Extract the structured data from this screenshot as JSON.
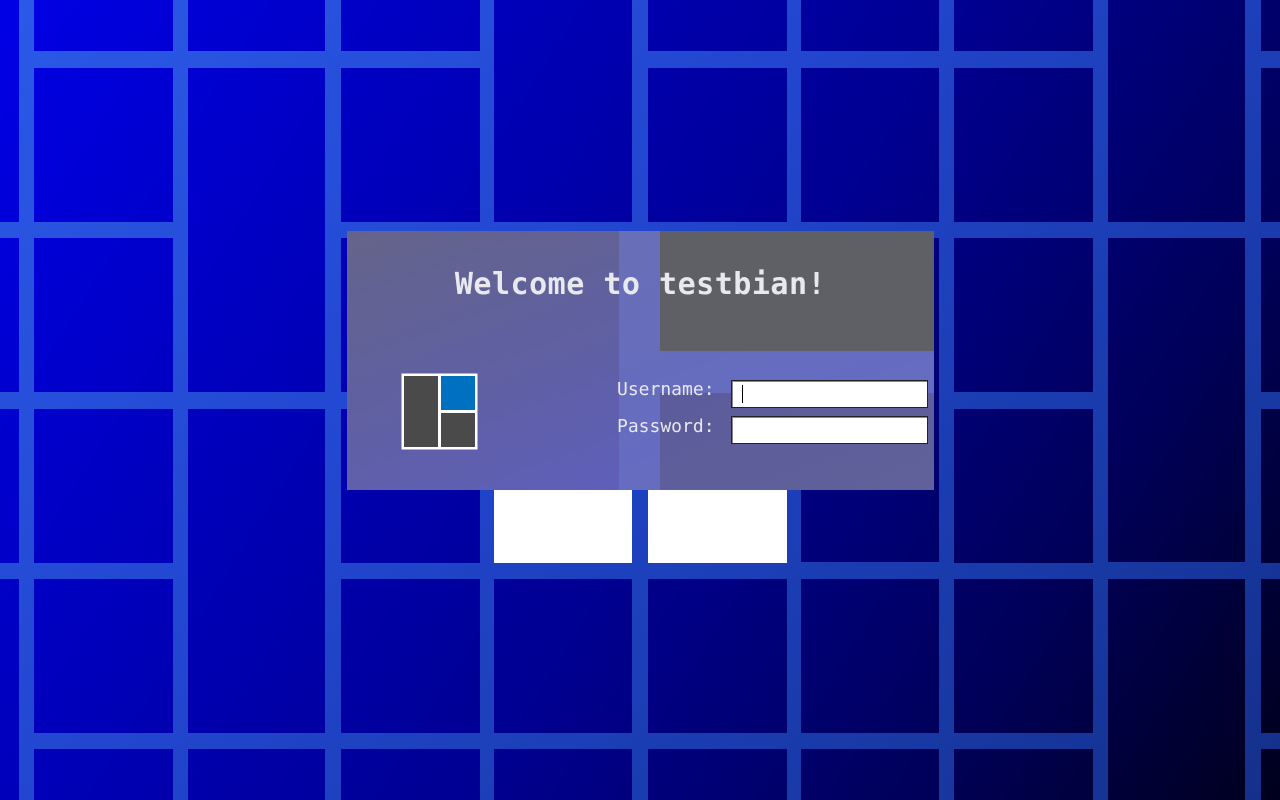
{
  "screen": {
    "type": "login-screen",
    "background_color": "#0000c0"
  },
  "dialog": {
    "welcome_text": "Welcome to testbian!",
    "username_label": "Username:",
    "password_label": "Password:",
    "username_value": "",
    "password_value": "",
    "logo_icon": "window-manager-logo-icon",
    "accent_color": "#0070c0",
    "panel_color": "#4a4a4a"
  }
}
